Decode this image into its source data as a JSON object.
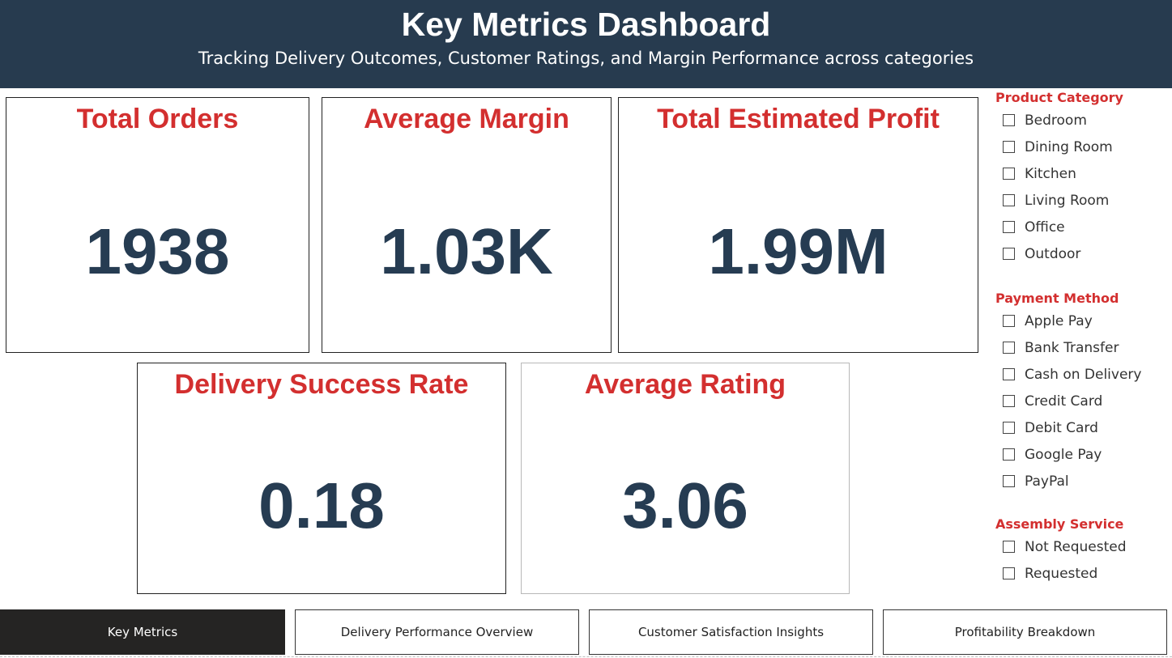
{
  "header": {
    "title": "Key Metrics Dashboard",
    "subtitle": "Tracking Delivery Outcomes, Customer Ratings, and Margin Performance across categories"
  },
  "kpis": [
    {
      "label": "Total Orders",
      "value": "1938"
    },
    {
      "label": "Average Margin",
      "value": "1.03K"
    },
    {
      "label": "Total Estimated Profit",
      "value": "1.99M"
    },
    {
      "label": "Delivery Success Rate",
      "value": "0.18"
    },
    {
      "label": "Average Rating",
      "value": "3.06"
    }
  ],
  "filters": {
    "product_category": {
      "title": "Product Category",
      "options": [
        "Bedroom",
        "Dining Room",
        "Kitchen",
        "Living Room",
        "Office",
        "Outdoor"
      ]
    },
    "payment_method": {
      "title": "Payment Method",
      "options": [
        "Apple Pay",
        "Bank Transfer",
        "Cash on Delivery",
        "Credit Card",
        "Debit Card",
        "Google Pay",
        "PayPal"
      ]
    },
    "assembly_service": {
      "title": "Assembly Service",
      "options": [
        "Not Requested",
        "Requested"
      ]
    }
  },
  "nav": [
    {
      "label": "Key Metrics",
      "active": true
    },
    {
      "label": "Delivery Performance Overview",
      "active": false
    },
    {
      "label": "Customer Satisfaction Insights",
      "active": false
    },
    {
      "label": "Profitability Breakdown",
      "active": false
    }
  ],
  "colors": {
    "header_bg": "#273b4f",
    "kpi_label": "#d32f2f",
    "kpi_value": "#263c52",
    "nav_active_bg": "#252423"
  }
}
